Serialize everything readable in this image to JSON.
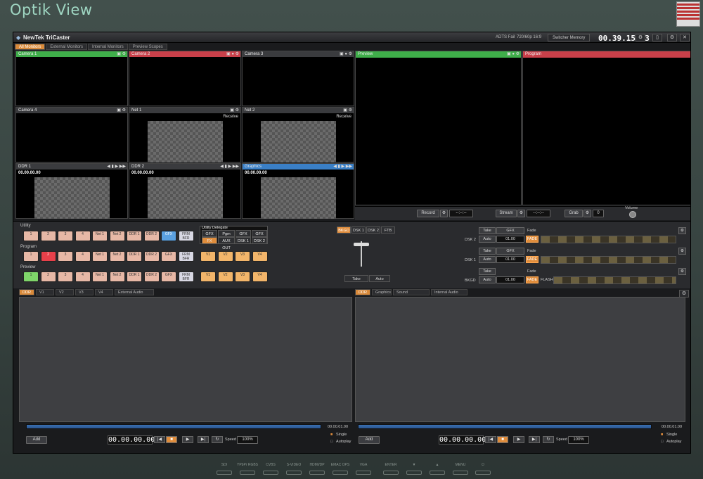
{
  "brand": "Optik View",
  "app": {
    "title": "NewTek TriCaster",
    "format_status": "ADTS Fail",
    "format_mode": "720/60p 16:9",
    "switcher_memory": "Switcher Memory",
    "clock": "00.39.15.23"
  },
  "top_tabs": [
    "All Monitors",
    "External Monitors",
    "Internal Monitors",
    "Preview Scopes"
  ],
  "monitors": [
    {
      "label": "Camera 1",
      "tc": ""
    },
    {
      "label": "Camera 2",
      "tc": ""
    },
    {
      "label": "Camera 3",
      "tc": ""
    },
    {
      "label": "Camera 4",
      "tc": ""
    },
    {
      "label": "Net 1",
      "tc": "",
      "receive": "Receive"
    },
    {
      "label": "Net 2",
      "tc": "",
      "receive": "Receive"
    },
    {
      "label": "DDR 1",
      "tc": "00.00.00.00"
    },
    {
      "label": "DDR 2",
      "tc": "00.00.00.00"
    },
    {
      "label": "Graphics",
      "tc": "00.00.00.00"
    }
  ],
  "preview": {
    "label": "Preview"
  },
  "program": {
    "label": "Program"
  },
  "output_controls": {
    "record": "Record",
    "record_time": "--:--:--",
    "stream": "Stream",
    "stream_time": "--:--:--",
    "grab": "Grab",
    "grab_count": "0",
    "volume": "Volume"
  },
  "switcher": {
    "utility_label": "Utility",
    "program_label": "Program",
    "preview_label": "Preview",
    "row_keys": [
      "1",
      "2",
      "3",
      "4",
      "Net 1",
      "Net 2",
      "DDR 1",
      "DDR 2",
      "GFX",
      "FRM BFR"
    ],
    "vkeys": [
      "V1",
      "V2",
      "V3",
      "V4"
    ],
    "delegate_title": "Utility Delegate",
    "delegate_top": [
      "GFX",
      "Pgm",
      "GFX",
      "GFX"
    ],
    "delegate_bottom": [
      "FX",
      "AUX OUT",
      "DSK 1",
      "DSK 2"
    ]
  },
  "transition": {
    "buttons": [
      "BKGD",
      "DSK 1",
      "DSK 2",
      "FTB"
    ],
    "take": "Take",
    "auto": "Auto"
  },
  "dsk_rows": [
    {
      "label": "DSK 2",
      "take": "Take",
      "src": "GFX",
      "fade": "Fade",
      "auto": "Auto",
      "dur": "01.00",
      "fadebtn": "FADE"
    },
    {
      "label": "DSK 1",
      "take": "Take",
      "src": "GFX",
      "fade": "Fade",
      "auto": "Auto",
      "dur": "01.00",
      "fadebtn": "FADE"
    },
    {
      "label": "BKGD",
      "take": "Take",
      "src": "",
      "fade": "Fade",
      "auto": "Auto",
      "dur": "01.00",
      "fadebtn": "FADE",
      "flash": "FLASH"
    }
  ],
  "left_media": {
    "tabs": [
      "DDR 1",
      "V1",
      "V2",
      "V3",
      "V4",
      "External Audio"
    ],
    "duration": "00.00.01.00",
    "add": "Add",
    "timecode": "00.00.00.00",
    "speed_label": "Speed",
    "speed": "100%",
    "single": "Single",
    "autoplay": "Autoplay"
  },
  "right_media": {
    "tabs": [
      "DDR 2",
      "Graphics",
      "Sound",
      "Internal Audio"
    ],
    "duration": "00.00.01.00",
    "add": "Add",
    "timecode": "00.00.00.00",
    "speed_label": "Speed",
    "speed": "100%",
    "single": "Single",
    "autoplay": "Autoplay"
  },
  "hardware_buttons": [
    "SDI",
    "YPbPr RGBS",
    "CVBS",
    "S-VIDEO",
    "HDMI/DP",
    "EMAC OPS",
    "VGA",
    "ENTER",
    "▼",
    "▲",
    "MENU",
    "⏻"
  ]
}
